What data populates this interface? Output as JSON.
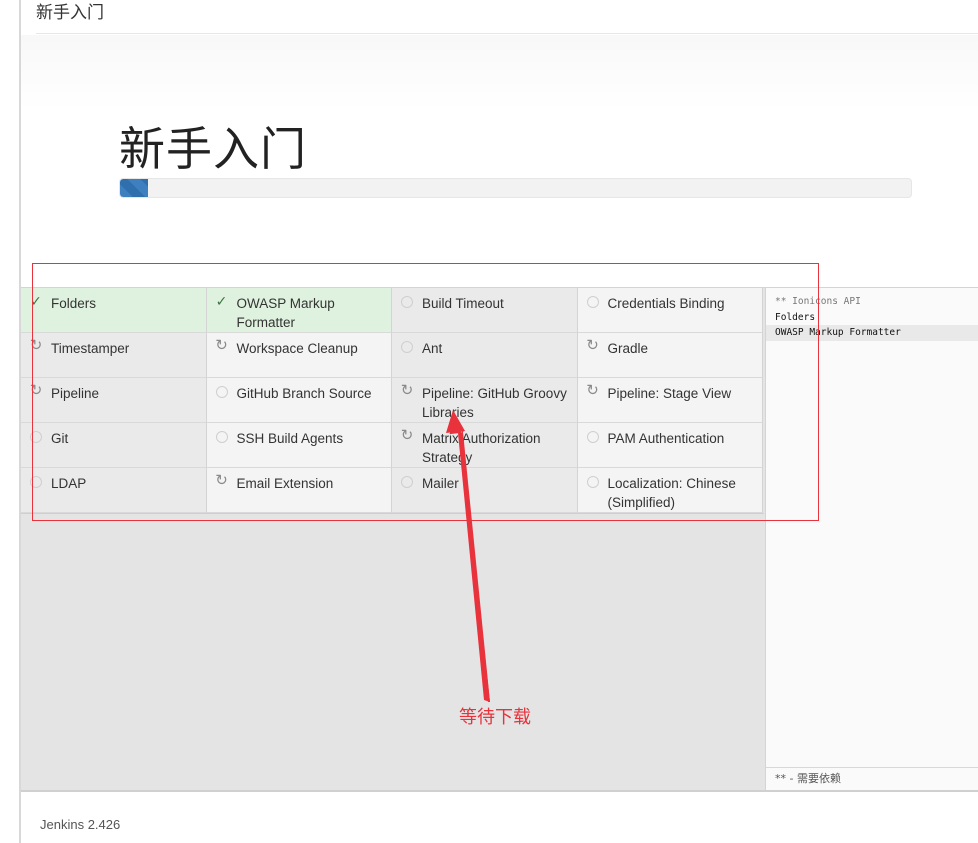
{
  "window": {
    "title": "新手入门"
  },
  "header": {
    "title": "新手入门",
    "progress_fraction": 0.035
  },
  "plugins": [
    {
      "label": "Folders",
      "status": "done",
      "icon": "check-icon"
    },
    {
      "label": "OWASP Markup Formatter",
      "status": "done",
      "icon": "check-icon"
    },
    {
      "label": "Build Timeout",
      "status": "pending",
      "icon": "circle-icon"
    },
    {
      "label": "Credentials Binding",
      "status": "pending",
      "icon": "circle-icon"
    },
    {
      "label": "Timestamper",
      "status": "installing",
      "icon": "spinner-icon"
    },
    {
      "label": "Workspace Cleanup",
      "status": "installing",
      "icon": "spinner-icon"
    },
    {
      "label": "Ant",
      "status": "pending",
      "icon": "circle-icon"
    },
    {
      "label": "Gradle",
      "status": "installing",
      "icon": "spinner-icon"
    },
    {
      "label": "Pipeline",
      "status": "installing",
      "icon": "spinner-icon"
    },
    {
      "label": "GitHub Branch Source",
      "status": "pending",
      "icon": "circle-icon"
    },
    {
      "label": "Pipeline: GitHub Groovy Libraries",
      "status": "installing",
      "icon": "spinner-icon"
    },
    {
      "label": "Pipeline: Stage View",
      "status": "installing",
      "icon": "spinner-icon"
    },
    {
      "label": "Git",
      "status": "pending",
      "icon": "circle-icon"
    },
    {
      "label": "SSH Build Agents",
      "status": "pending",
      "icon": "circle-icon"
    },
    {
      "label": "Matrix Authorization Strategy",
      "status": "installing",
      "icon": "spinner-icon"
    },
    {
      "label": "PAM Authentication",
      "status": "pending",
      "icon": "circle-icon"
    },
    {
      "label": "LDAP",
      "status": "pending",
      "icon": "circle-icon"
    },
    {
      "label": "Email Extension",
      "status": "installing",
      "icon": "spinner-icon"
    },
    {
      "label": "Mailer",
      "status": "pending",
      "icon": "circle-icon"
    },
    {
      "label": "Localization: Chinese (Simplified)",
      "status": "pending",
      "icon": "circle-icon"
    }
  ],
  "log": {
    "lines": [
      "** Ionicons API",
      "Folders",
      "OWASP Markup Formatter"
    ],
    "footer": "** - 需要依赖"
  },
  "footer": {
    "version": "Jenkins 2.426"
  },
  "annotation": {
    "label": "等待下载",
    "color": "#e8323c"
  },
  "colors": {
    "done_bg": "#dff2df",
    "progress": "#3e7fbf",
    "accent": "#e8323c"
  }
}
